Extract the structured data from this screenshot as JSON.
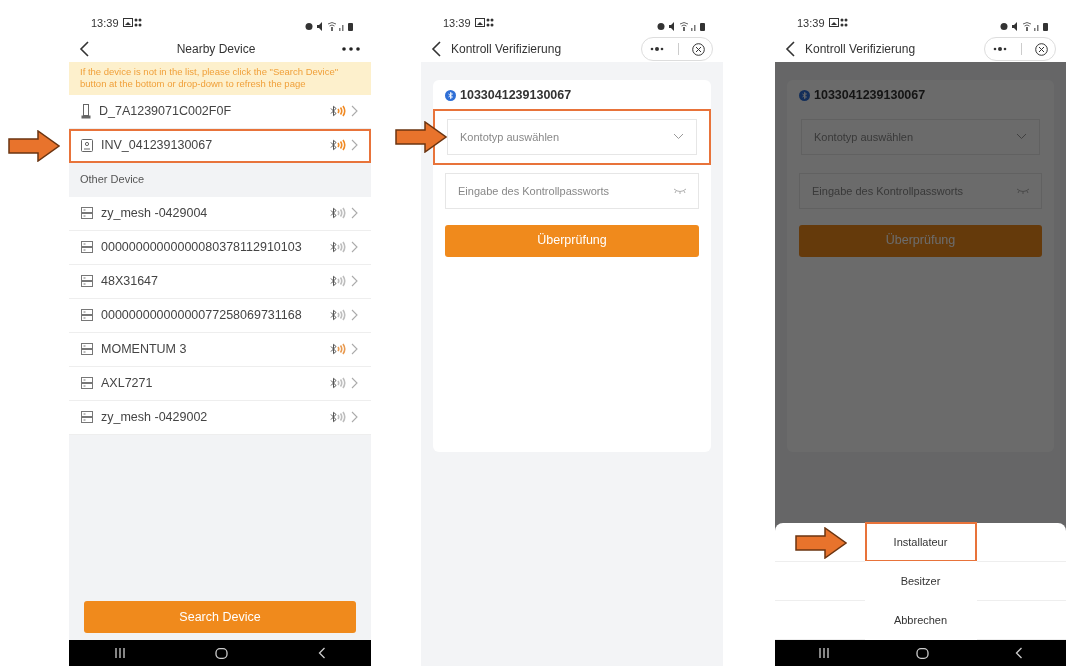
{
  "nearby_screen": {
    "status_time": "13:39",
    "title": "Nearby Device",
    "notice": "If the device is not in the list, please click the \"Search Device\" button at the bottom or drop-down to refresh the page",
    "devices": [
      {
        "kind": "battery",
        "name": "D_7A1239071C002F0F",
        "color": "#f08a24",
        "highlighted": false
      },
      {
        "kind": "inverter",
        "name": "INV_041239130067",
        "color": "#f08a24",
        "highlighted": true
      }
    ],
    "other_heading": "Other Device",
    "other_devices": [
      {
        "kind": "mesh",
        "name": "zy_mesh -0429004",
        "color": "#bdbdbd",
        "highlighted": false
      },
      {
        "kind": "mesh",
        "name": "00000000000000080378112910103",
        "color": "#bdbdbd",
        "highlighted": false
      },
      {
        "kind": "mesh",
        "name": "48X31647",
        "color": "#bdbdbd",
        "highlighted": false
      },
      {
        "kind": "mesh",
        "name": "00000000000000077258069731168",
        "color": "#bdbdbd",
        "highlighted": false
      },
      {
        "kind": "mesh",
        "name": "MOMENTUM 3",
        "color": "#e89a50",
        "highlighted": false
      },
      {
        "kind": "mesh",
        "name": "AXL7271",
        "color": "#bdbdbd",
        "highlighted": false
      },
      {
        "kind": "mesh",
        "name": "zy_mesh -0429002",
        "color": "#bdbdbd",
        "highlighted": false
      }
    ],
    "search_button": "Search Device"
  },
  "verify_screen": {
    "status_time": "13:39",
    "title": "Kontroll Verifizierung",
    "device_id": "1033041239130067",
    "account_select": {
      "placeholder": "Kontotyp auswählen",
      "highlighted": true
    },
    "password_field": {
      "placeholder": "Eingabe des Kontrollpassworts"
    },
    "submit_button": "Überprüfung"
  },
  "sheet_screen": {
    "status_time": "13:39",
    "title": "Kontroll Verifizierung",
    "device_id": "1033041239130067",
    "account_select": {
      "placeholder": "Kontotyp auswählen",
      "highlighted": false
    },
    "password_field": {
      "placeholder": "Eingabe des Kontrollpassworts"
    },
    "submit_button": "Überprüfung",
    "sheet_options": [
      {
        "label": "Installateur",
        "highlighted": true
      },
      {
        "label": "Besitzer",
        "highlighted": false
      },
      {
        "label": "Abbrechen",
        "highlighted": false
      }
    ]
  }
}
